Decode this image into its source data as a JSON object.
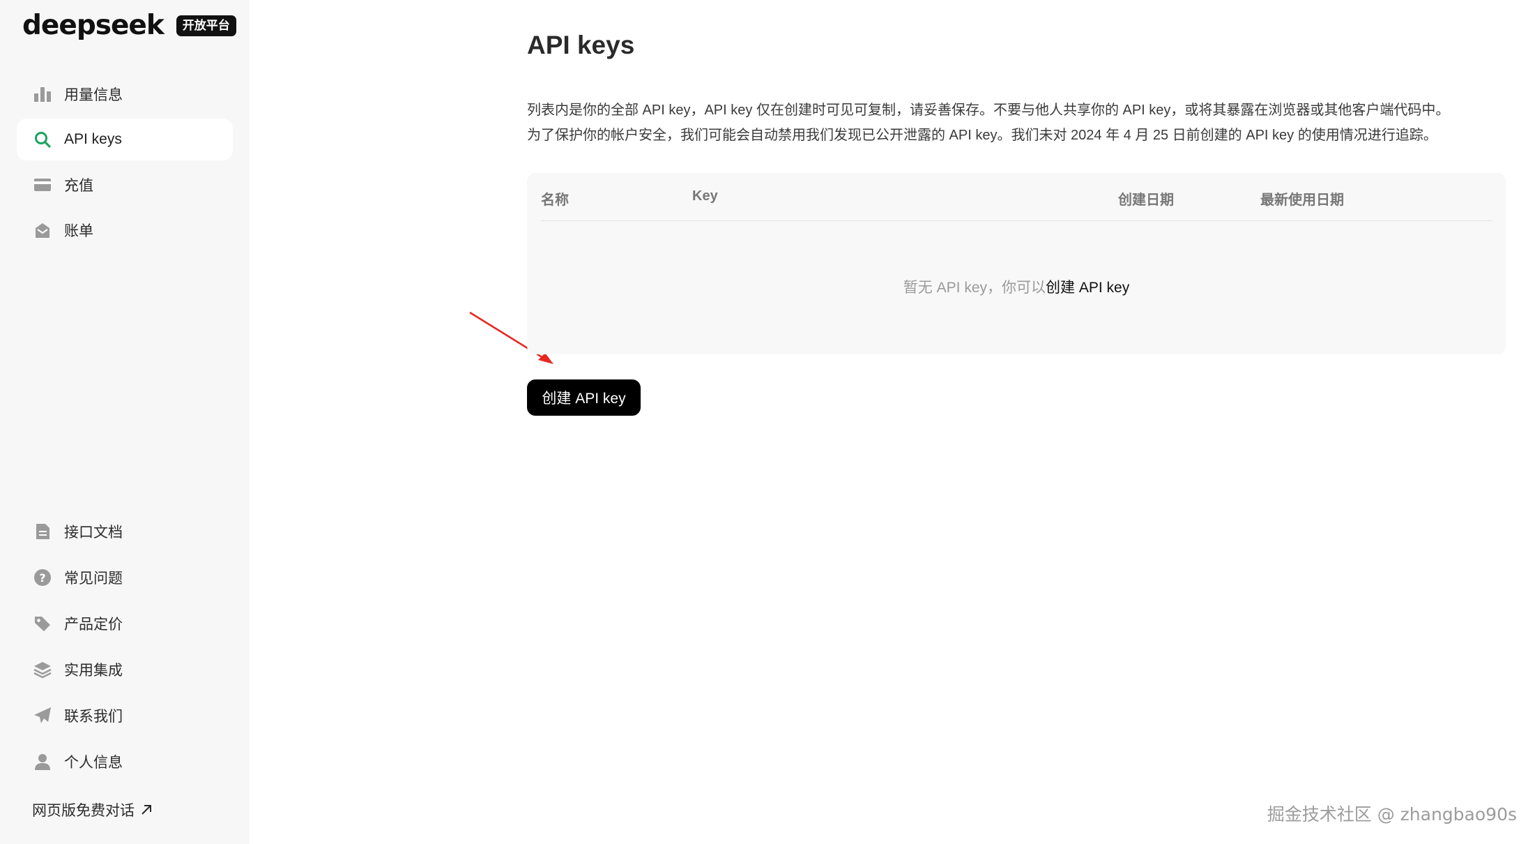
{
  "brand": {
    "logo_text": "deepseek",
    "badge": "开放平台"
  },
  "sidebar": {
    "top_items": [
      {
        "label": "用量信息",
        "icon": "bar-chart-icon",
        "active": false
      },
      {
        "label": "API keys",
        "icon": "search-icon",
        "active": true
      },
      {
        "label": "充值",
        "icon": "credit-card-icon",
        "active": false
      },
      {
        "label": "账单",
        "icon": "inbox-icon",
        "active": false
      }
    ],
    "bottom_items": [
      {
        "label": "接口文档",
        "icon": "document-icon"
      },
      {
        "label": "常见问题",
        "icon": "question-icon"
      },
      {
        "label": "产品定价",
        "icon": "tag-icon"
      },
      {
        "label": "实用集成",
        "icon": "layers-icon"
      },
      {
        "label": "联系我们",
        "icon": "paper-plane-icon"
      },
      {
        "label": "个人信息",
        "icon": "user-icon"
      }
    ],
    "web_link": "网页版免费对话"
  },
  "main": {
    "title": "API keys",
    "description_line1": "列表内是你的全部 API key，API key 仅在创建时可见可复制，请妥善保存。不要与他人共享你的 API key，或将其暴露在浏览器或其他客户端代码中。",
    "description_line2": "为了保护你的帐户安全，我们可能会自动禁用我们发现已公开泄露的 API key。我们未对 2024 年 4 月 25 日前创建的 API key 的使用情况进行追踪。",
    "table": {
      "columns": [
        "名称",
        "Key",
        "创建日期",
        "最新使用日期"
      ],
      "empty_text": "暂无 API key，你可以",
      "empty_link": "创建 API key"
    },
    "create_button": "创建 API key"
  },
  "watermark": "掘金技术社区 @ zhangbao90s",
  "colors": {
    "accent_green": "#1aa35f",
    "annotation_arrow": "#e8261f",
    "sidebar_bg": "#f7f7f8"
  }
}
